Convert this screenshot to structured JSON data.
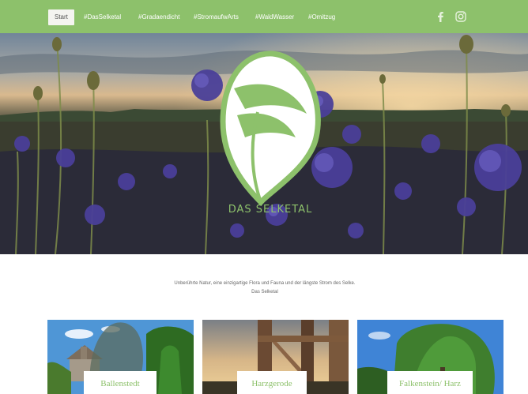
{
  "nav": {
    "tabs": [
      {
        "label": "Start",
        "active": true
      },
      {
        "label": "#DasSelketal",
        "active": false
      },
      {
        "label": "#Gradaendicht",
        "active": false
      },
      {
        "label": "#StromaufwArts",
        "active": false
      },
      {
        "label": "#WaldWasser",
        "active": false
      },
      {
        "label": "#Omitzug",
        "active": false
      }
    ],
    "social": [
      {
        "icon": "facebook-icon"
      },
      {
        "icon": "instagram-icon"
      }
    ]
  },
  "hero": {
    "logo_text": "DAS SELKETAL",
    "logo_color": "#8dc16b"
  },
  "intro": {
    "line1": "Unberührte Natur, eine einzigartige Flora und Fauna und der längste Strom des Selke.",
    "line2": "Das Selketal"
  },
  "cards": [
    {
      "label": "Ballenstedt"
    },
    {
      "label": "Harzgerode"
    },
    {
      "label": "Falkenstein/ Harz"
    }
  ],
  "colors": {
    "accent": "#8dc16b",
    "nav_bg": "#8dc16b",
    "page_bg": "#ffffff"
  }
}
